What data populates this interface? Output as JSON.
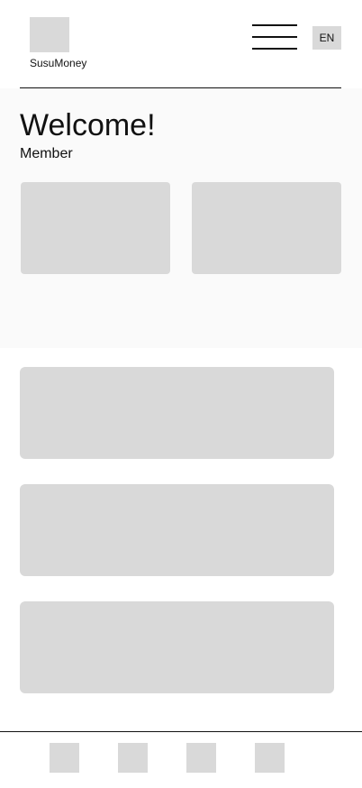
{
  "header": {
    "app_name": "SusuMoney",
    "language_label": "EN",
    "logo_icon": "logo-placeholder",
    "menu_icon": "hamburger-icon"
  },
  "welcome": {
    "title": "Welcome!",
    "subtitle": "Member"
  },
  "colors": {
    "placeholder": "#d9d9d9",
    "panel_background": "#fafafa",
    "text": "#111111",
    "divider": "#111111"
  }
}
